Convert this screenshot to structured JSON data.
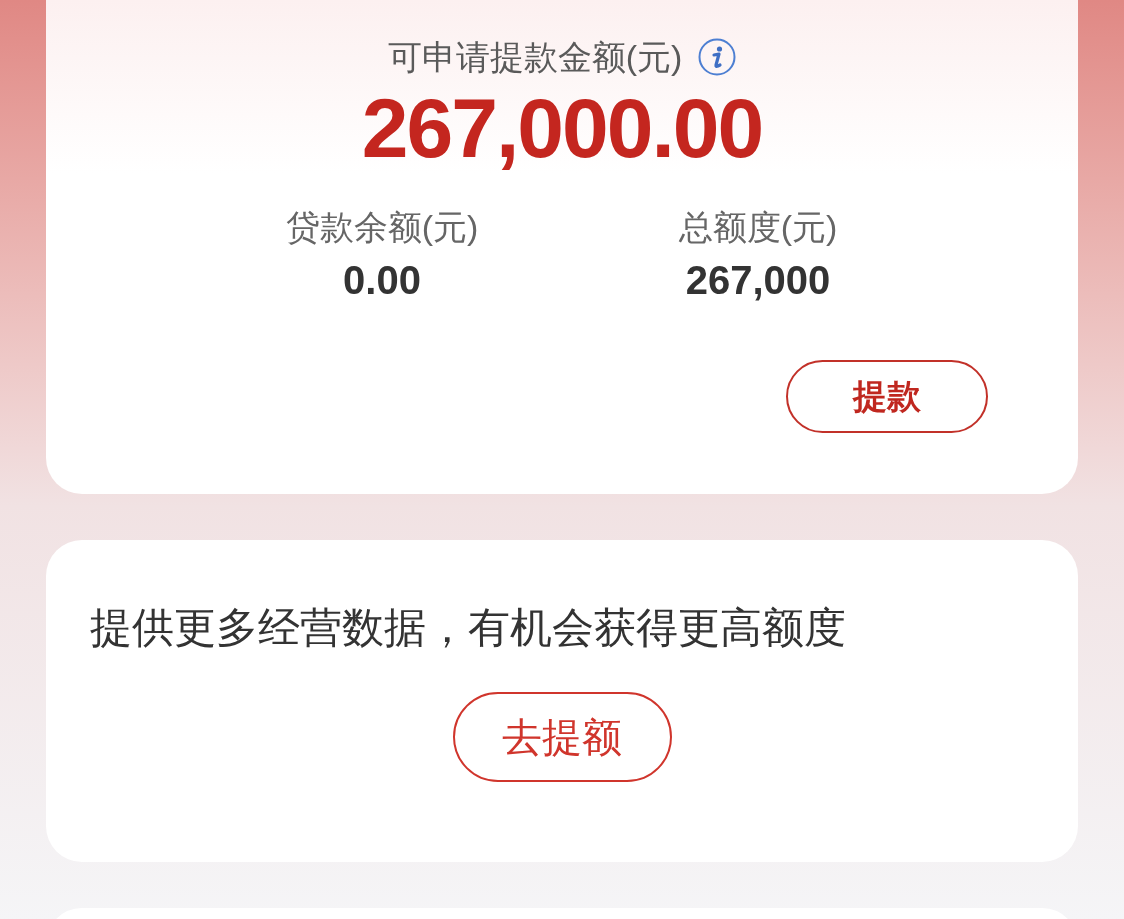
{
  "balance_card": {
    "label": "可申请提款金额(元)",
    "amount": "267,000.00",
    "stats": [
      {
        "label": "贷款余额(元)",
        "value": "0.00"
      },
      {
        "label": "总额度(元)",
        "value": "267,000"
      }
    ],
    "button": "提款"
  },
  "promo_card": {
    "text": "提供更多经营数据，有机会获得更高额度",
    "button": "去提额"
  }
}
